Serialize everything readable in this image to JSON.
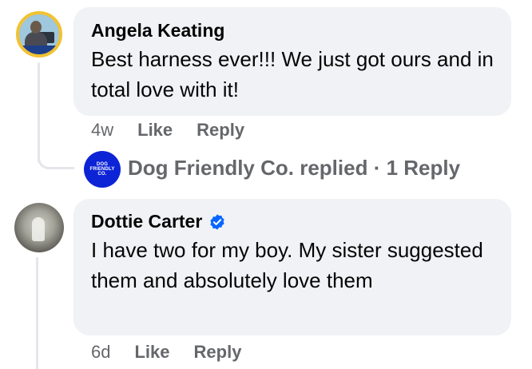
{
  "comments": [
    {
      "author": "Angela Keating",
      "text": "Best harness ever!!! We just got ours and in total love with it!",
      "time": "4w",
      "like_label": "Like",
      "reply_label": "Reply"
    },
    {
      "author": "Dottie Carter",
      "text": "I have two for my boy. My sister suggested them and absolutely love them",
      "time": "6d",
      "like_label": "Like",
      "reply_label": "Reply"
    }
  ],
  "reply_preview": {
    "text": "Dog Friendly Co. replied · 1 Reply",
    "logo_lines": [
      "DOG",
      "FRIENDLY",
      "CO."
    ]
  },
  "colors": {
    "bubble": "#f0f2f5",
    "secondary_text": "#65676b",
    "verified": "#0866ff",
    "logo_bg": "#0c24d6"
  }
}
